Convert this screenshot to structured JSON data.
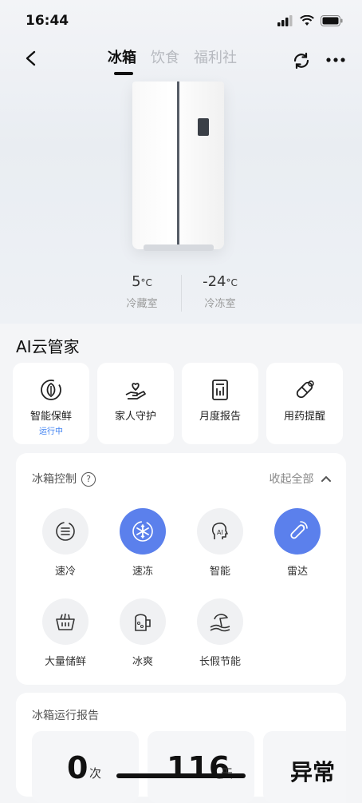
{
  "status": {
    "time": "16:44"
  },
  "nav": {
    "tabs": [
      "冰箱",
      "饮食",
      "福利社"
    ]
  },
  "temps": [
    {
      "value": "5",
      "unit": "°C",
      "label": "冷藏室"
    },
    {
      "value": "-24",
      "unit": "°C",
      "label": "冷冻室"
    }
  ],
  "ai": {
    "title": "AI云管家",
    "cards": [
      {
        "label": "智能保鲜",
        "sub": "运行中",
        "icon": "leaf-circle-icon"
      },
      {
        "label": "家人守护",
        "icon": "heart-hand-icon"
      },
      {
        "label": "月度报告",
        "icon": "report-icon"
      },
      {
        "label": "用药提醒",
        "icon": "pill-icon"
      }
    ]
  },
  "control": {
    "title": "冰箱控制",
    "help": "?",
    "collapse": "收起全部",
    "items": [
      {
        "label": "速冷",
        "icon": "quick-cool-icon",
        "active": false
      },
      {
        "label": "速冻",
        "icon": "snowflake-icon",
        "active": true
      },
      {
        "label": "智能",
        "icon": "ai-head-icon",
        "active": false
      },
      {
        "label": "雷达",
        "icon": "radar-icon",
        "active": true
      },
      {
        "label": "大量储鲜",
        "icon": "basket-icon",
        "active": false
      },
      {
        "label": "冰爽",
        "icon": "beer-mug-icon",
        "active": false
      },
      {
        "label": "长假节能",
        "icon": "island-icon",
        "active": false
      }
    ]
  },
  "report": {
    "title": "冰箱运行报告",
    "cards": [
      {
        "value": "0",
        "unit": "次"
      },
      {
        "value": "116",
        "unit": "天"
      },
      {
        "value": "异常",
        "unit": ""
      }
    ]
  },
  "colors": {
    "accent": "#5b80ec",
    "sub_text": "#3b7ff1"
  }
}
